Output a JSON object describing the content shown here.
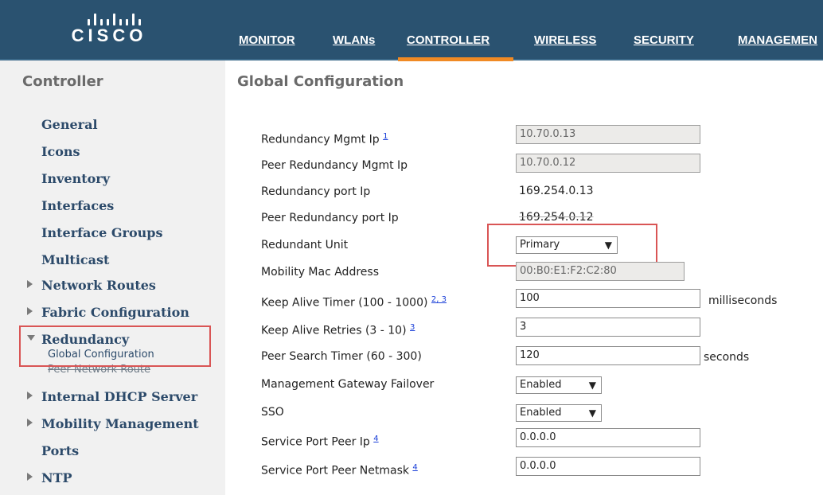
{
  "brand": {
    "logo_text": "CISCO"
  },
  "nav": [
    "MONITOR",
    "WLANs",
    "CONTROLLER",
    "WIRELESS",
    "SECURITY",
    "MANAGEMEN"
  ],
  "sidebar": {
    "title": "Controller",
    "items": [
      "General",
      "Icons",
      "Inventory",
      "Interfaces",
      "Interface Groups",
      "Multicast",
      "Network Routes",
      "Fabric Configuration",
      "Redundancy",
      "Internal DHCP Server",
      "Mobility Management",
      "Ports",
      "NTP"
    ],
    "subitems": [
      "Global Configuration",
      "Peer Network Route"
    ]
  },
  "main": {
    "title": "Global Configuration",
    "rows": [
      {
        "label": "Redundancy Mgmt Ip",
        "fn": "1",
        "value": "10.70.0.13"
      },
      {
        "label": "Peer Redundancy Mgmt Ip",
        "value": "10.70.0.12"
      },
      {
        "label": "Redundancy port Ip",
        "value": "169.254.0.13"
      },
      {
        "label": "Peer Redundancy port Ip",
        "value": "169.254.0.12"
      },
      {
        "label": "Redundant Unit",
        "value": "Primary"
      },
      {
        "label": "Mobility Mac Address",
        "value": "00:B0:E1:F2:C2:80"
      },
      {
        "label": "Keep Alive Timer (100 - 1000)",
        "fn": "2, 3",
        "value": "100",
        "unit": "milliseconds"
      },
      {
        "label": "Keep Alive Retries (3 - 10)",
        "fn": "3",
        "value": "3"
      },
      {
        "label": "Peer Search Timer (60 - 300)",
        "value": "120",
        "unit": "seconds"
      },
      {
        "label": "Management Gateway Failover",
        "value": "Enabled"
      },
      {
        "label": "SSO",
        "value": "Enabled"
      },
      {
        "label": "Service Port Peer Ip",
        "fn": "4",
        "value": "0.0.0.0"
      },
      {
        "label": "Service Port Peer Netmask",
        "fn": "4",
        "value": "0.0.0.0"
      }
    ]
  },
  "colors": {
    "header": "#2a5270",
    "active_tab": "#f08a24",
    "highlight": "#d95555",
    "sidebar_bg": "#f1f1f1"
  }
}
